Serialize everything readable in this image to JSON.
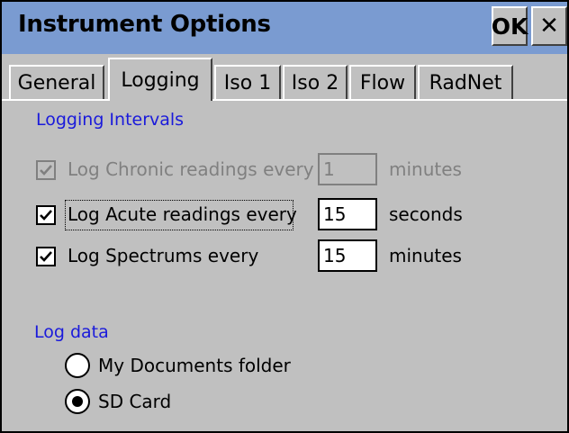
{
  "window": {
    "title": "Instrument Options",
    "ok_label": "OK",
    "close_glyph": "✕"
  },
  "tabs": [
    {
      "label": "General",
      "active": false
    },
    {
      "label": "Logging",
      "active": true
    },
    {
      "label": "Iso 1",
      "active": false
    },
    {
      "label": "Iso 2",
      "active": false
    },
    {
      "label": "Flow",
      "active": false
    },
    {
      "label": "RadNet",
      "active": false
    }
  ],
  "logging_intervals": {
    "heading": "Logging Intervals",
    "rows": [
      {
        "label": "Log Chronic readings every",
        "checked": true,
        "enabled": false,
        "value": "1",
        "unit": "minutes"
      },
      {
        "label": "Log Acute readings every",
        "checked": true,
        "enabled": true,
        "focused": true,
        "value": "15",
        "unit": "seconds"
      },
      {
        "label": "Log Spectrums every",
        "checked": true,
        "enabled": true,
        "value": "15",
        "unit": "minutes"
      }
    ]
  },
  "log_data": {
    "heading": "Log data",
    "options": [
      {
        "label": "My Documents folder",
        "selected": false
      },
      {
        "label": "SD Card",
        "selected": true
      }
    ]
  },
  "colors": {
    "title_bar": "#7a9bd1",
    "window_bg": "#c0c0c0",
    "group_heading": "#1a1adb",
    "disabled_text": "#808080"
  },
  "icons": {
    "close": "close-icon",
    "checkbox_mark": "checkmark-icon",
    "radio_dot": "radio-dot-icon"
  }
}
